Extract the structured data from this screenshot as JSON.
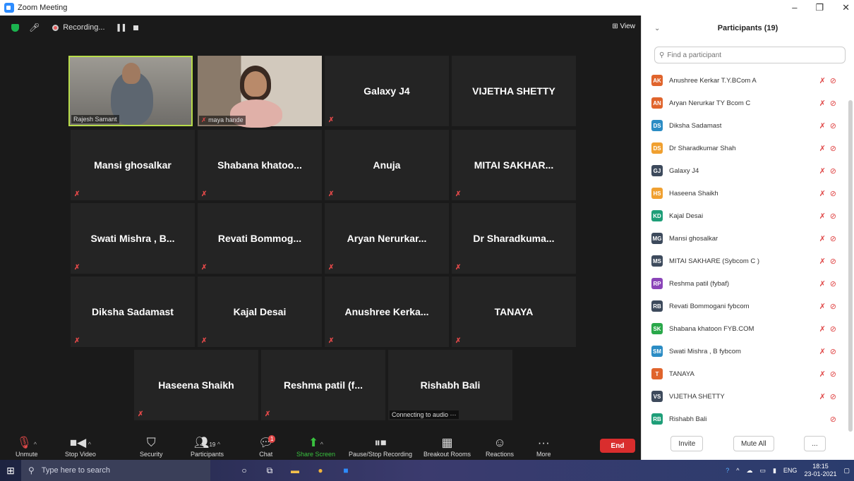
{
  "window": {
    "title": "Zoom Meeting",
    "controls": [
      "–",
      "❐",
      "✕"
    ]
  },
  "topbar": {
    "recording_label": "Recording...",
    "view_label": "View"
  },
  "tiles": [
    {
      "name": "Rajesh Samant",
      "kind": "video"
    },
    {
      "name": "maya hande",
      "kind": "video"
    },
    {
      "name": "Galaxy J4",
      "kind": "name"
    },
    {
      "name": "VIJETHA SHETTY",
      "kind": "name"
    },
    {
      "name": "Mansi ghosalkar",
      "kind": "name"
    },
    {
      "name": "Shabana khatoo...",
      "kind": "name"
    },
    {
      "name": "Anuja",
      "kind": "name"
    },
    {
      "name": "MITAI SAKHAR...",
      "kind": "name"
    },
    {
      "name": "Swati Mishra , B...",
      "kind": "name"
    },
    {
      "name": "Revati Bommog...",
      "kind": "name"
    },
    {
      "name": "Aryan Nerurkar...",
      "kind": "name"
    },
    {
      "name": "Dr Sharadkuma...",
      "kind": "name"
    },
    {
      "name": "Diksha Sadamast",
      "kind": "name"
    },
    {
      "name": "Kajal Desai",
      "kind": "name"
    },
    {
      "name": "Anushree Kerka...",
      "kind": "name"
    },
    {
      "name": "TANAYA",
      "kind": "name"
    },
    {
      "name": "Haseena Shaikh",
      "kind": "name"
    },
    {
      "name": "Reshma patil (f...",
      "kind": "name"
    },
    {
      "name": "Rishabh Bali",
      "kind": "name",
      "caption": "Connecting to audio ···"
    }
  ],
  "toolbar": {
    "unmute": "Unmute",
    "stop_video": "Stop Video",
    "security": "Security",
    "participants": "Participants",
    "participants_count": "19",
    "chat": "Chat",
    "chat_badge": "1",
    "share_screen": "Share Screen",
    "pause_recording": "Pause/Stop Recording",
    "breakout": "Breakout Rooms",
    "reactions": "Reactions",
    "more": "More",
    "end": "End"
  },
  "panel": {
    "title": "Participants (19)",
    "search_placeholder": "Find a participant",
    "invite": "Invite",
    "mute_all": "Mute All",
    "more": "...",
    "participants": [
      {
        "initials": "AK",
        "name": "Anushree Kerkar T.Y.BCom A",
        "color": "#e0642c"
      },
      {
        "initials": "AN",
        "name": "Aryan Nerurkar TY Bcom C",
        "color": "#e0642c"
      },
      {
        "initials": "DS",
        "name": "Diksha Sadamast",
        "color": "#2b8cc4"
      },
      {
        "initials": "DS",
        "name": "Dr Sharadkumar Shah",
        "color": "#f0a030"
      },
      {
        "initials": "GJ",
        "name": "Galaxy J4",
        "color": "#3d4a5c"
      },
      {
        "initials": "HS",
        "name": "Haseena Shaikh",
        "color": "#f0a030"
      },
      {
        "initials": "KD",
        "name": "Kajal Desai",
        "color": "#1e9e78"
      },
      {
        "initials": "MG",
        "name": "Mansi ghosalkar",
        "color": "#3d4a5c"
      },
      {
        "initials": "MS",
        "name": "MITAI SAKHARE (Sybcom C )",
        "color": "#3d4a5c"
      },
      {
        "initials": "RP",
        "name": "Reshma patil (fybaf)",
        "color": "#8a44b8"
      },
      {
        "initials": "RB",
        "name": "Revati Bommogani fybcom",
        "color": "#3d4a5c"
      },
      {
        "initials": "SK",
        "name": "Shabana khatoon FYB.COM",
        "color": "#2aa84a"
      },
      {
        "initials": "SM",
        "name": "Swati Mishra , B fybcom",
        "color": "#2b8cc4"
      },
      {
        "initials": "T",
        "name": "TANAYA",
        "color": "#e0642c"
      },
      {
        "initials": "VS",
        "name": "VIJETHA SHETTY",
        "color": "#3d4a5c"
      },
      {
        "initials": "RB",
        "name": "Rishabh Bali",
        "color": "#1e9e78"
      }
    ]
  },
  "taskbar": {
    "search_placeholder": "Type here to search",
    "lang": "ENG",
    "time": "18:15",
    "date": "23-01-2021"
  }
}
